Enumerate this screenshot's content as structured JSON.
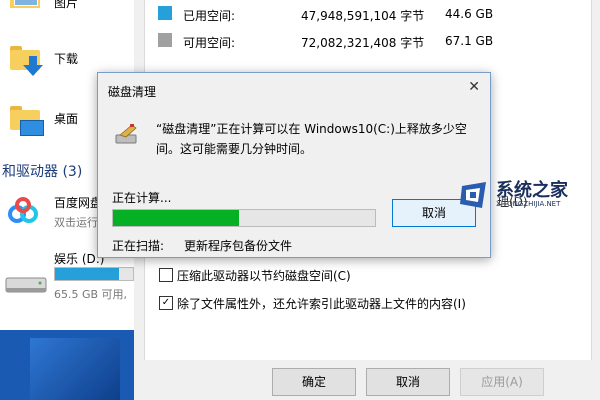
{
  "explorer": {
    "items": [
      {
        "label": "图片",
        "icon": "pictures-folder-icon"
      },
      {
        "label": "下载",
        "icon": "downloads-folder-icon"
      },
      {
        "label": "桌面",
        "icon": "desktop-folder-icon"
      }
    ],
    "section_header": "和驱动器 (3)",
    "drives": [
      {
        "label": "百度网盘",
        "sub": "双击运行",
        "icon": "baidu-netdisk-icon"
      },
      {
        "label": "娱乐 (D:)",
        "sub": "65.5 GB 可用,",
        "icon": "hard-drive-icon",
        "used_fraction": 0.82
      }
    ]
  },
  "properties": {
    "used": {
      "label": "已用空间:",
      "bytes": "47,948,591,104 字节",
      "size": "44.6 GB",
      "color": "#26a0da"
    },
    "free": {
      "label": "可用空间:",
      "bytes": "72,082,321,408 字节",
      "size": "67.1 GB",
      "color": "#a0a0a0"
    },
    "partial_label": "理(D)",
    "options": [
      {
        "label": "压缩此驱动器以节约磁盘空间(C)",
        "checked": false
      },
      {
        "label": "除了文件属性外，还允许索引此驱动器上文件的内容(I)",
        "checked": true
      }
    ],
    "buttons": {
      "ok": "确定",
      "cancel": "取消",
      "apply": "应用(A)"
    }
  },
  "dialog": {
    "title": "磁盘清理",
    "close": "✕",
    "message": "“磁盘清理”正在计算可以在 Windows10(C:)上释放多少空间。这可能需要几分钟时间。",
    "progress_label": "正在计算...",
    "progress_fraction": 0.48,
    "cancel": "取消",
    "scan_label": "正在扫描:",
    "scan_value": "更新程序包备份文件",
    "progress_color": "#06b025"
  },
  "watermark": {
    "title": "系统之家",
    "subtitle": "XITONGZHIJIA.NET"
  }
}
